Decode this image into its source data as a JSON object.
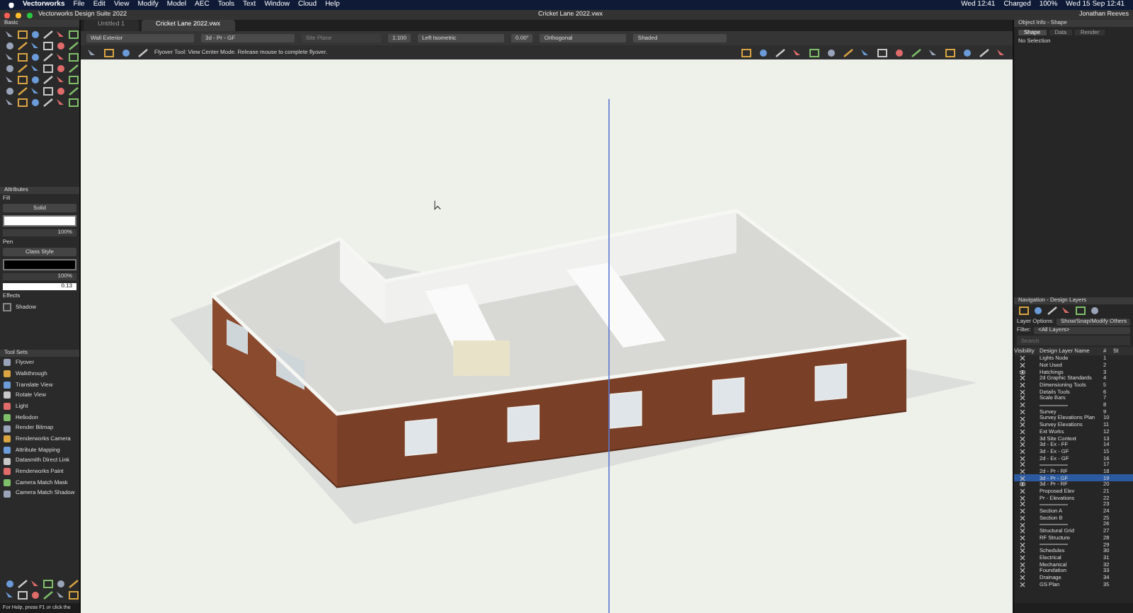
{
  "menu_bar": {
    "app": "Vectorworks",
    "items": [
      "File",
      "Edit",
      "View",
      "Modify",
      "Model",
      "AEC",
      "Tools",
      "Text",
      "Window",
      "Cloud",
      "Help"
    ],
    "status": [
      "Wed 12:41",
      "Charged",
      "100%",
      "Wed 15 Sep 12:41"
    ]
  },
  "window": {
    "title": "Vectorworks Design Suite 2022",
    "document": "Cricket Lane 2022.vwx",
    "user": "Jonathan Reeves"
  },
  "basic_palette": {
    "title": "Basic"
  },
  "attributes": {
    "title": "Attributes",
    "fill_label": "Fill",
    "fill_style": "Solid",
    "fill_opacity": "100%",
    "pen_label": "Pen",
    "pen_style": "Class Style",
    "pen_opacity": "100%",
    "line_weight": "0.13",
    "effects_label": "Effects",
    "shadow_label": "Shadow",
    "shadow_checked": false
  },
  "tool_sets": {
    "title": "Tool Sets",
    "items": [
      "Flyover",
      "Walkthrough",
      "Translate View",
      "Rotate View",
      "Light",
      "Heliodon",
      "Render Bitmap",
      "Renderworks Camera",
      "Attribute Mapping",
      "Datasmith Direct Link",
      "Renderworks Paint",
      "Camera Match Mask",
      "Camera Match Shadow"
    ]
  },
  "status_bar": "For Help, press F1 or click the",
  "tabs": [
    {
      "label": "Untitled 1",
      "selected": false
    },
    {
      "label": "Cricket Lane 2022.vwx",
      "selected": true
    }
  ],
  "view_bar": {
    "class": "Wall Exterior",
    "layer": "3d - Pr - GF",
    "plane": "Site Plane",
    "scale": "1:100",
    "view": "Left Isometric",
    "angle": "0.00°",
    "projection": "Orthogonal",
    "render_mode": "Shaded"
  },
  "tool_message": "Flyover Tool: View Center Mode. Release mouse to complete flyover.",
  "object_info": {
    "title": "Object Info - Shape",
    "tabs": [
      {
        "label": "Shape",
        "selected": true
      },
      {
        "label": "Data",
        "selected": false
      },
      {
        "label": "Render",
        "selected": false
      }
    ],
    "selection": "No Selection"
  },
  "navigation": {
    "title": "Navigation - Design Layers",
    "layer_options_label": "Layer Options:",
    "layer_options": "Show/Snap/Modify Others",
    "filter_label": "Filter:",
    "filter": "<All Layers>",
    "search_placeholder": "Search",
    "columns": [
      "Visibility",
      "Design Layer Name",
      "#",
      "St"
    ],
    "rows": [
      {
        "kind": "layer",
        "visible": false,
        "name": "Lights Node",
        "number": "1",
        "selected": false
      },
      {
        "kind": "layer",
        "visible": false,
        "name": "Not Used",
        "number": "2",
        "selected": false
      },
      {
        "kind": "layer",
        "visible": true,
        "name": "Hatchings",
        "number": "3",
        "selected": false
      },
      {
        "kind": "layer",
        "visible": false,
        "name": "2d Graphic Standards",
        "number": "4",
        "selected": false
      },
      {
        "kind": "layer",
        "visible": false,
        "name": "Dimensioning Tools",
        "number": "5",
        "selected": false
      },
      {
        "kind": "layer",
        "visible": false,
        "name": "Details Tools",
        "number": "6",
        "selected": false
      },
      {
        "kind": "layer",
        "visible": false,
        "name": "Scale Bars",
        "number": "7",
        "selected": false
      },
      {
        "kind": "separator",
        "visible": false,
        "number": "8",
        "selected": false
      },
      {
        "kind": "layer",
        "visible": false,
        "name": "Survey",
        "number": "9",
        "selected": false
      },
      {
        "kind": "layer",
        "visible": false,
        "name": "Survey Elevations Plan",
        "number": "10",
        "selected": false
      },
      {
        "kind": "layer",
        "visible": false,
        "name": "Survey Elevations",
        "number": "11",
        "selected": false
      },
      {
        "kind": "layer",
        "visible": false,
        "name": "Ext Works",
        "number": "12",
        "selected": false
      },
      {
        "kind": "layer",
        "visible": false,
        "name": "3d Site Context",
        "number": "13",
        "selected": false
      },
      {
        "kind": "layer",
        "visible": false,
        "name": "3d - Ex - FF",
        "number": "14",
        "selected": false
      },
      {
        "kind": "layer",
        "visible": false,
        "name": "3d - Ex - GF",
        "number": "15",
        "selected": false
      },
      {
        "kind": "layer",
        "visible": false,
        "name": "2d - Ex - GF",
        "number": "16",
        "selected": false
      },
      {
        "kind": "separator",
        "visible": false,
        "number": "17",
        "selected": false
      },
      {
        "kind": "layer",
        "visible": false,
        "name": "2d - Pr - RF",
        "number": "18",
        "selected": false
      },
      {
        "kind": "layer",
        "visible": false,
        "name": "3d - Pr - GF",
        "number": "19",
        "selected": true
      },
      {
        "kind": "layer",
        "visible": true,
        "name": "3d - Pr - RF",
        "number": "20",
        "selected": false
      },
      {
        "kind": "layer",
        "visible": false,
        "name": "Proposed Elev",
        "number": "21",
        "selected": false
      },
      {
        "kind": "layer",
        "visible": false,
        "name": "Pr - Elevations",
        "number": "22",
        "selected": false
      },
      {
        "kind": "separator",
        "visible": false,
        "number": "23",
        "selected": false
      },
      {
        "kind": "layer",
        "visible": false,
        "name": "Section A",
        "number": "24",
        "selected": false
      },
      {
        "kind": "layer",
        "visible": false,
        "name": "Section B",
        "number": "25",
        "selected": false
      },
      {
        "kind": "separator",
        "visible": false,
        "number": "26",
        "selected": false
      },
      {
        "kind": "layer",
        "visible": false,
        "name": "Structural Grid",
        "number": "27",
        "selected": false
      },
      {
        "kind": "layer",
        "visible": false,
        "name": "RF Structure",
        "number": "28",
        "selected": false
      },
      {
        "kind": "separator",
        "visible": false,
        "number": "29",
        "selected": false
      },
      {
        "kind": "layer",
        "visible": false,
        "name": "Schedules",
        "number": "30",
        "selected": false
      },
      {
        "kind": "layer",
        "visible": false,
        "name": "Electrical",
        "number": "31",
        "selected": false
      },
      {
        "kind": "layer",
        "visible": false,
        "name": "Mechanical",
        "number": "32",
        "selected": false
      },
      {
        "kind": "layer",
        "visible": false,
        "name": "Foundation",
        "number": "33",
        "selected": false
      },
      {
        "kind": "layer",
        "visible": false,
        "name": "Drainage",
        "number": "34",
        "selected": false
      },
      {
        "kind": "layer",
        "visible": false,
        "name": "GS Plan",
        "number": "35",
        "selected": false
      }
    ]
  }
}
